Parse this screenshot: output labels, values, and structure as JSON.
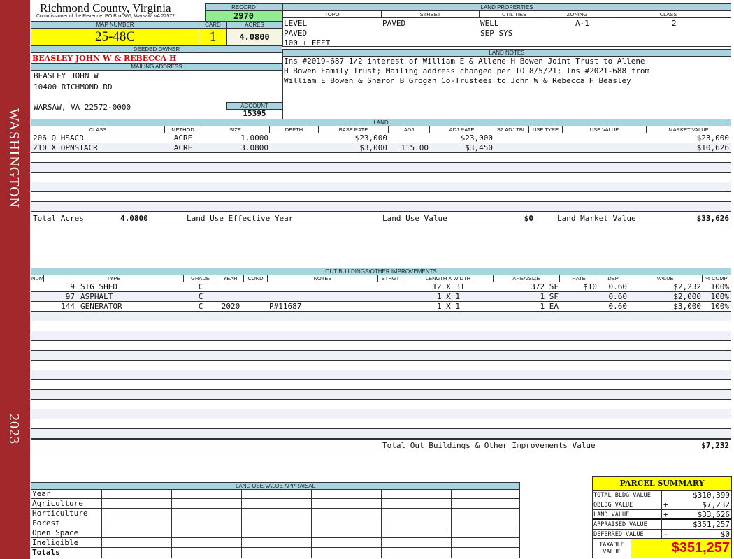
{
  "sidebar": {
    "district": "WASHINGTON",
    "year": "2023",
    "color": "#a3282b"
  },
  "header": {
    "county": "Richmond County, Virginia",
    "office": "Commissioner of the Revenue, PO Box 366, Warsaw, VA 22572",
    "record_label": "RECORD",
    "record": "2970",
    "map_label": "MAP NUMBER",
    "map_number": "25-48C",
    "card_label": "CARD",
    "card": "1",
    "acres_label": "ACRES",
    "acres": "4.0800"
  },
  "owner": {
    "deeded_label": "DEEDED OWNER",
    "deeded_owner": "BEASLEY JOHN W & REBECCA H",
    "mailing_label": "MAILING ADDRESS",
    "address": [
      "BEASLEY JOHN W",
      "10400 RICHMOND RD",
      "",
      "WARSAW, VA 22572-0000"
    ],
    "account_label": "ACCOUNT",
    "account": "15395"
  },
  "land_properties": {
    "title": "LAND PROPERTIES",
    "columns": [
      "TOPO",
      "STREET",
      "UTILITIES",
      "ZONING",
      "CLASS"
    ],
    "topo": [
      "LEVEL",
      "PAVED",
      "100 + FEET"
    ],
    "street": [
      "PAVED"
    ],
    "utilities": [
      "WELL",
      "SEP SYS"
    ],
    "zoning": "A-1",
    "class": "2"
  },
  "land_notes": {
    "title": "LAND NOTES",
    "lines": [
      "Ins #2019-687 1/2 interest of William E & Allene H Bowen Joint Trust to Allene",
      "H Bowen Family Trust; Mailing address changed per TO 8/5/21; Ins #2021-688 from",
      "William E Bowen & Sharon B Grogan Co-Trustees to John W & Rebecca H Beasley"
    ]
  },
  "land": {
    "title": "LAND",
    "columns": [
      "CLASS",
      "METHOD",
      "SIZE",
      "DEPTH",
      "BASE RATE",
      "ADJ",
      "ADJ RATE",
      "SZ ADJ TBL",
      "USE TYPE",
      "USE VALUE",
      "MARKET VALUE"
    ],
    "rows": [
      [
        "206 Q HSACR",
        "ACRE",
        "1.0000",
        "",
        "$23,000",
        "",
        "$23,000",
        "",
        "",
        "",
        "$23,000"
      ],
      [
        "210 X OPNSTACR",
        "ACRE",
        "3.0800",
        "",
        "$3,000",
        "115.00",
        "$3,450",
        "",
        "",
        "",
        "$10,626"
      ]
    ],
    "totals": {
      "total_acres_label": "Total Acres",
      "total_acres": "4.0800",
      "effective_year_label": "Land Use Effective Year",
      "use_value_label": "Land Use Value",
      "use_value": "$0",
      "market_value_label": "Land Market Value",
      "market_value": "$33,626"
    }
  },
  "outbuildings": {
    "title": "OUT BUILDINGS/OTHER IMPROVEMENTS",
    "columns": [
      "NUM",
      "TYPE",
      "GRADE",
      "YEAR",
      "COND",
      "NOTES",
      "STHGT",
      "LENGTH X WIDTH",
      "AREA/SIZE",
      "RATE",
      "DEP",
      "VALUE",
      "% COMP"
    ],
    "rows": [
      [
        "9",
        "STG SHED",
        "C",
        "",
        "",
        "",
        "",
        "12 X 31",
        "372 SF",
        "$10",
        "0.60",
        "$2,232",
        "100%"
      ],
      [
        "97",
        "ASPHALT",
        "C",
        "",
        "",
        "",
        "",
        "1 X 1",
        "1 SF",
        "",
        "0.60",
        "$2,000",
        "100%"
      ],
      [
        "144",
        "GENERATOR",
        "C",
        "2020",
        "",
        "P#11687",
        "",
        "1 X 1",
        "1 EA",
        "",
        "0.60",
        "$3,000",
        "100%"
      ]
    ],
    "total_label": "Total Out Buildings & Other Improvements Value",
    "total": "$7,232"
  },
  "land_use_appraisal": {
    "title": "LAND USE VALUE APPRAISAL",
    "rows": [
      "Year",
      "Agriculture",
      "Horticulture",
      "Forest",
      "Open Space",
      "Ineligible",
      "Totals"
    ]
  },
  "summary": {
    "title": "PARCEL SUMMARY",
    "rows": [
      {
        "label": "TOTAL BLDG VALUE",
        "op": "",
        "value": "$310,399"
      },
      {
        "label": "OBLDG VALUE",
        "op": "+",
        "value": "$7,232"
      },
      {
        "label": "LAND VALUE",
        "op": "+",
        "value": "$33,626"
      },
      {
        "label": "APPRAISED VALUE",
        "op": "",
        "value": "$351,257"
      },
      {
        "label": "DEFERRED VALUE",
        "op": "-",
        "value": "$0"
      }
    ],
    "taxable_label": "TAXABLE VALUE",
    "taxable": "$351,257"
  }
}
